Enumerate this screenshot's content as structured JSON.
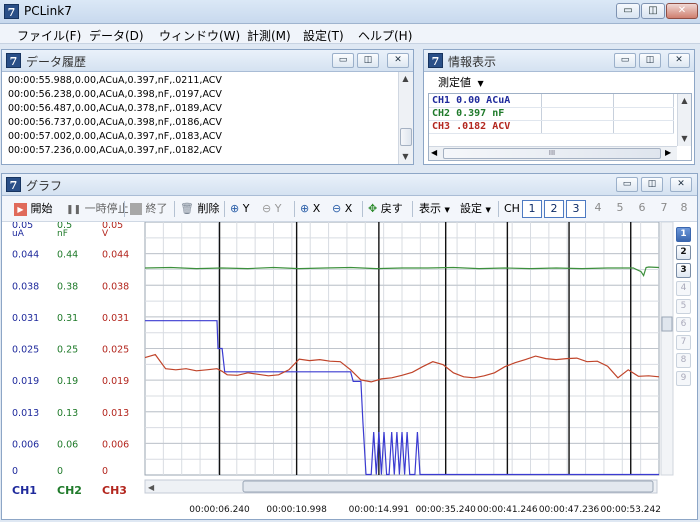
{
  "app": {
    "title": "PCLink7",
    "icon_letter": "7"
  },
  "menu": [
    "ファイル(F)",
    "データ(D)",
    "ウィンドウ(W)",
    "計測(M)",
    "設定(T)",
    "ヘルプ(H)"
  ],
  "window_buttons": {
    "min": "▭",
    "restore": "◫",
    "close": "✕"
  },
  "history_panel": {
    "title": "データ履歴",
    "lines": [
      "00:00:55.988,0.00,ACuA,0.397,nF,.0211,ACV",
      "00:00:56.238,0.00,ACuA,0.398,nF,.0197,ACV",
      "00:00:56.487,0.00,ACuA,0.378,nF,.0189,ACV",
      "00:00:56.737,0.00,ACuA,0.398,nF,.0186,ACV",
      "00:00:57.002,0.00,ACuA,0.397,nF,.0183,ACV",
      "00:00:57.236,0.00,ACuA,0.397,nF,.0182,ACV"
    ]
  },
  "info_panel": {
    "title": "情報表示",
    "dropdown": "測定値",
    "rows": [
      {
        "text": "CH1 0.00 ACuA",
        "color": "#1f2a9c"
      },
      {
        "text": "CH2 0.397 nF",
        "color": "#1f7a2a"
      },
      {
        "text": "CH3 .0182 ACV",
        "color": "#b3261e"
      }
    ],
    "scroll_glyph": "III"
  },
  "graph_panel": {
    "title": "グラフ",
    "toolbar": {
      "start": "開始",
      "pause": "一時停止",
      "stop": "終了",
      "delete": "削除",
      "zoom_in_y": "Y",
      "zoom_out_y": "Y",
      "zoom_in_x": "X",
      "zoom_out_x": "X",
      "back": "戻す",
      "display": "表示",
      "settings": "設定",
      "ch_label": "CH",
      "channels": [
        "1",
        "2",
        "3",
        "4",
        "5",
        "6",
        "7",
        "8"
      ]
    },
    "side_channels": [
      "1",
      "2",
      "3",
      "4",
      "5",
      "6",
      "7",
      "8",
      "9"
    ],
    "footer_channels": [
      {
        "name": "CH1",
        "color": "#1f2a9c"
      },
      {
        "name": "CH2",
        "color": "#1f7a2a"
      },
      {
        "name": "CH3",
        "color": "#b3261e"
      }
    ]
  },
  "chart_data": {
    "type": "line",
    "axes": [
      {
        "channel": "CH1",
        "color": "#1f2a9c",
        "unit": "uA",
        "ticks": [
          "0.05",
          "0.044",
          "0.038",
          "0.031",
          "0.025",
          "0.019",
          "0.013",
          "0.006",
          "0"
        ],
        "ylim": [
          0,
          0.05
        ]
      },
      {
        "channel": "CH2",
        "color": "#1f7a2a",
        "unit": "nF",
        "ticks": [
          "0.5",
          "0.44",
          "0.38",
          "0.31",
          "0.25",
          "0.19",
          "0.13",
          "0.06",
          "0"
        ],
        "ylim": [
          0,
          0.5
        ]
      },
      {
        "channel": "CH3",
        "color": "#b3261e",
        "unit": "V",
        "ticks": [
          "0.05",
          "0.044",
          "0.038",
          "0.031",
          "0.025",
          "0.019",
          "0.013",
          "0.006",
          "0"
        ],
        "ylim": [
          0,
          0.05
        ]
      }
    ],
    "x_ticks": [
      "00:00:06.240",
      "00:00:10.998",
      "00:00:14.991",
      "00:00:35.240",
      "00:00:41.246",
      "00:00:47.236",
      "00:00:53.242"
    ],
    "x_range": [
      0,
      100
    ],
    "grid": true,
    "series": [
      {
        "name": "CH1",
        "color": "#3b3bd1",
        "x": [
          0,
          14,
          14.2,
          15,
          15.5,
          40,
          40.5,
          41,
          41.5,
          42,
          42.4,
          43,
          44,
          44.5,
          45,
          45.5,
          46,
          46.5,
          47,
          47.5,
          48,
          48.5,
          49,
          49.5,
          50,
          50.5,
          51,
          51.5,
          52,
          52.5,
          53,
          53.5,
          54,
          54.5,
          100
        ],
        "y": [
          0.0305,
          0.0305,
          0.025,
          0.025,
          0.0204,
          0.0204,
          0.0185,
          0.0185,
          0.0185,
          0.0185,
          0.0105,
          0.0001,
          0.0001,
          0.0085,
          0.0001,
          0.0085,
          0.0001,
          0.0085,
          0.0001,
          0.0001,
          0.0085,
          0.0001,
          0.0085,
          0.0001,
          0.0085,
          0.0001,
          0.0085,
          0.0001,
          0.0001,
          0.0001,
          0.0085,
          0.0001,
          0.0001,
          0.0001,
          0.0001
        ]
      },
      {
        "name": "CH2",
        "color": "#3c8f3c",
        "x": [
          0,
          5,
          10,
          15,
          20,
          25,
          30,
          35,
          40,
          45,
          50,
          55,
          60,
          65,
          70,
          75,
          80,
          85,
          90,
          95,
          96.5,
          97,
          97.5,
          98,
          100
        ],
        "y": [
          0.409,
          0.41,
          0.408,
          0.409,
          0.408,
          0.41,
          0.408,
          0.409,
          0.41,
          0.408,
          0.409,
          0.409,
          0.41,
          0.408,
          0.409,
          0.408,
          0.409,
          0.408,
          0.409,
          0.409,
          0.402,
          0.394,
          0.41,
          0.411,
          0.41
        ]
      },
      {
        "name": "CH3",
        "color": "#c0442a",
        "x": [
          0,
          2,
          4,
          6,
          8,
          10,
          12,
          14,
          15,
          16,
          18,
          20,
          22,
          24,
          26,
          28,
          30,
          32,
          34,
          36,
          38,
          40,
          42,
          44,
          46,
          48,
          50,
          52,
          54,
          56,
          58,
          60,
          62,
          64,
          66,
          68,
          70,
          72,
          74,
          76,
          78,
          80,
          82,
          84,
          86,
          88,
          90,
          92,
          94,
          96,
          98,
          100
        ],
        "y": [
          0.0232,
          0.0238,
          0.021,
          0.0208,
          0.021,
          0.0206,
          0.0208,
          0.021,
          0.0205,
          0.0198,
          0.0197,
          0.0202,
          0.0199,
          0.0196,
          0.0198,
          0.0208,
          0.0229,
          0.0226,
          0.0228,
          0.0225,
          0.0224,
          0.0208,
          0.0188,
          0.0184,
          0.019,
          0.0192,
          0.0197,
          0.0203,
          0.0214,
          0.0224,
          0.0218,
          0.0202,
          0.0194,
          0.0192,
          0.0196,
          0.0202,
          0.0214,
          0.0222,
          0.0228,
          0.0235,
          0.023,
          0.0228,
          0.023,
          0.0231,
          0.0224,
          0.0225,
          0.0215,
          0.0192,
          0.0208,
          0.0195,
          0.0196,
          0.0194
        ]
      }
    ],
    "markers_x": [
      14.5,
      29.5,
      45.5,
      58.5,
      70.5,
      82.5,
      94.5
    ]
  }
}
